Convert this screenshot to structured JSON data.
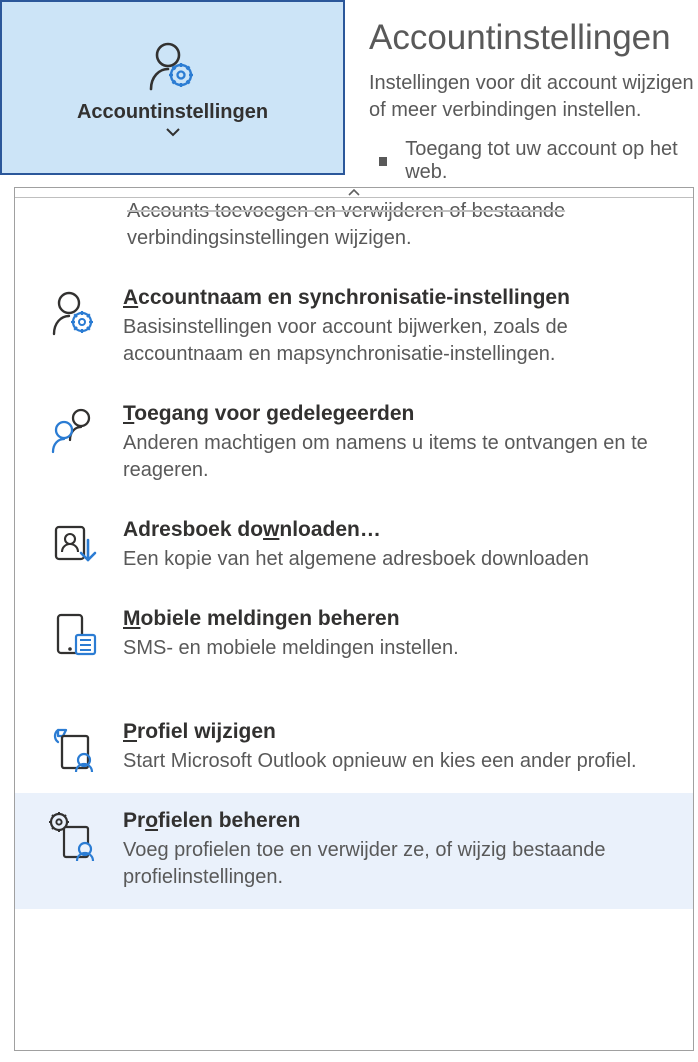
{
  "ribbon": {
    "button_label": "Accountinstellingen"
  },
  "header": {
    "title": "Accountinstellingen",
    "subtitle": "Instellingen voor dit account wijzigen of meer verbindingen instellen.",
    "bullet": "Toegang tot uw account op het web."
  },
  "cutoff": {
    "line1": "Accounts toevoegen en verwijderen of bestaande",
    "line2": "verbindingsinstellingen wijzigen."
  },
  "menu": {
    "account_name": {
      "prefix": "A",
      "rest": "ccountnaam en synchronisatie-instellingen",
      "desc": "Basisinstellingen voor account bijwerken, zoals de accountnaam en mapsynchronisatie-instellingen."
    },
    "delegate": {
      "prefix": "T",
      "rest": "oegang voor gedelegeerden",
      "desc": "Anderen machtigen om namens u items te ontvangen en te reageren."
    },
    "download_ab": {
      "pre": "Adresboek do",
      "ul": "w",
      "post": "nloaden…",
      "desc": "Een kopie van het algemene adresboek downloaden"
    },
    "mobile": {
      "prefix": "M",
      "rest": "obiele meldingen beheren",
      "desc": "SMS- en mobiele meldingen instellen."
    },
    "change_profile": {
      "prefix": "P",
      "rest": "rofiel wijzigen",
      "desc": "Start  Microsoft Outlook opnieuw en kies een ander profiel."
    },
    "manage_profiles": {
      "pre": "Pr",
      "ul": "o",
      "post": "fielen beheren",
      "desc": "Voeg profielen toe en verwijder ze, of wijzig bestaande profielinstellingen."
    }
  }
}
